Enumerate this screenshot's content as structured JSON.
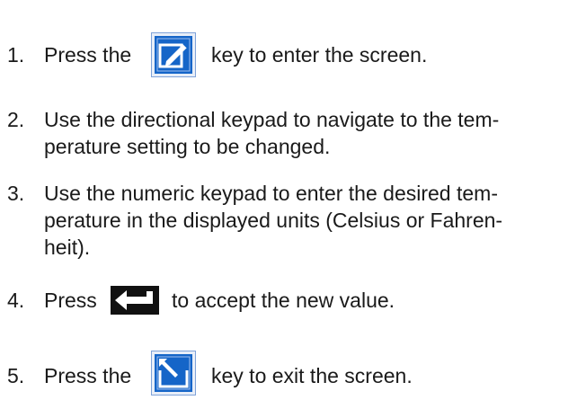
{
  "steps": [
    {
      "number": "1.",
      "before_icon": "Press the",
      "icon": "edit-screen-key-icon",
      "after_icon": "key to enter the screen."
    },
    {
      "number": "2.",
      "lines": [
        "Use the directional keypad to navigate to the tem-",
        "perature setting to be changed."
      ]
    },
    {
      "number": "3.",
      "lines": [
        "Use the numeric keypad to enter the desired tem-",
        "perature in the displayed units (Celsius or Fahren-",
        "heit)."
      ]
    },
    {
      "number": "4.",
      "before_icon": "Press",
      "icon": "enter-key-icon",
      "after_icon": "to accept the new value."
    },
    {
      "number": "5.",
      "before_icon": "Press the",
      "icon": "exit-screen-key-icon",
      "after_icon": "key to exit the screen."
    }
  ],
  "colors": {
    "text": "#1a1a1a",
    "key_blue": "#1565c8",
    "key_border": "#7fa3d9",
    "enter_key_bg": "#111111"
  }
}
